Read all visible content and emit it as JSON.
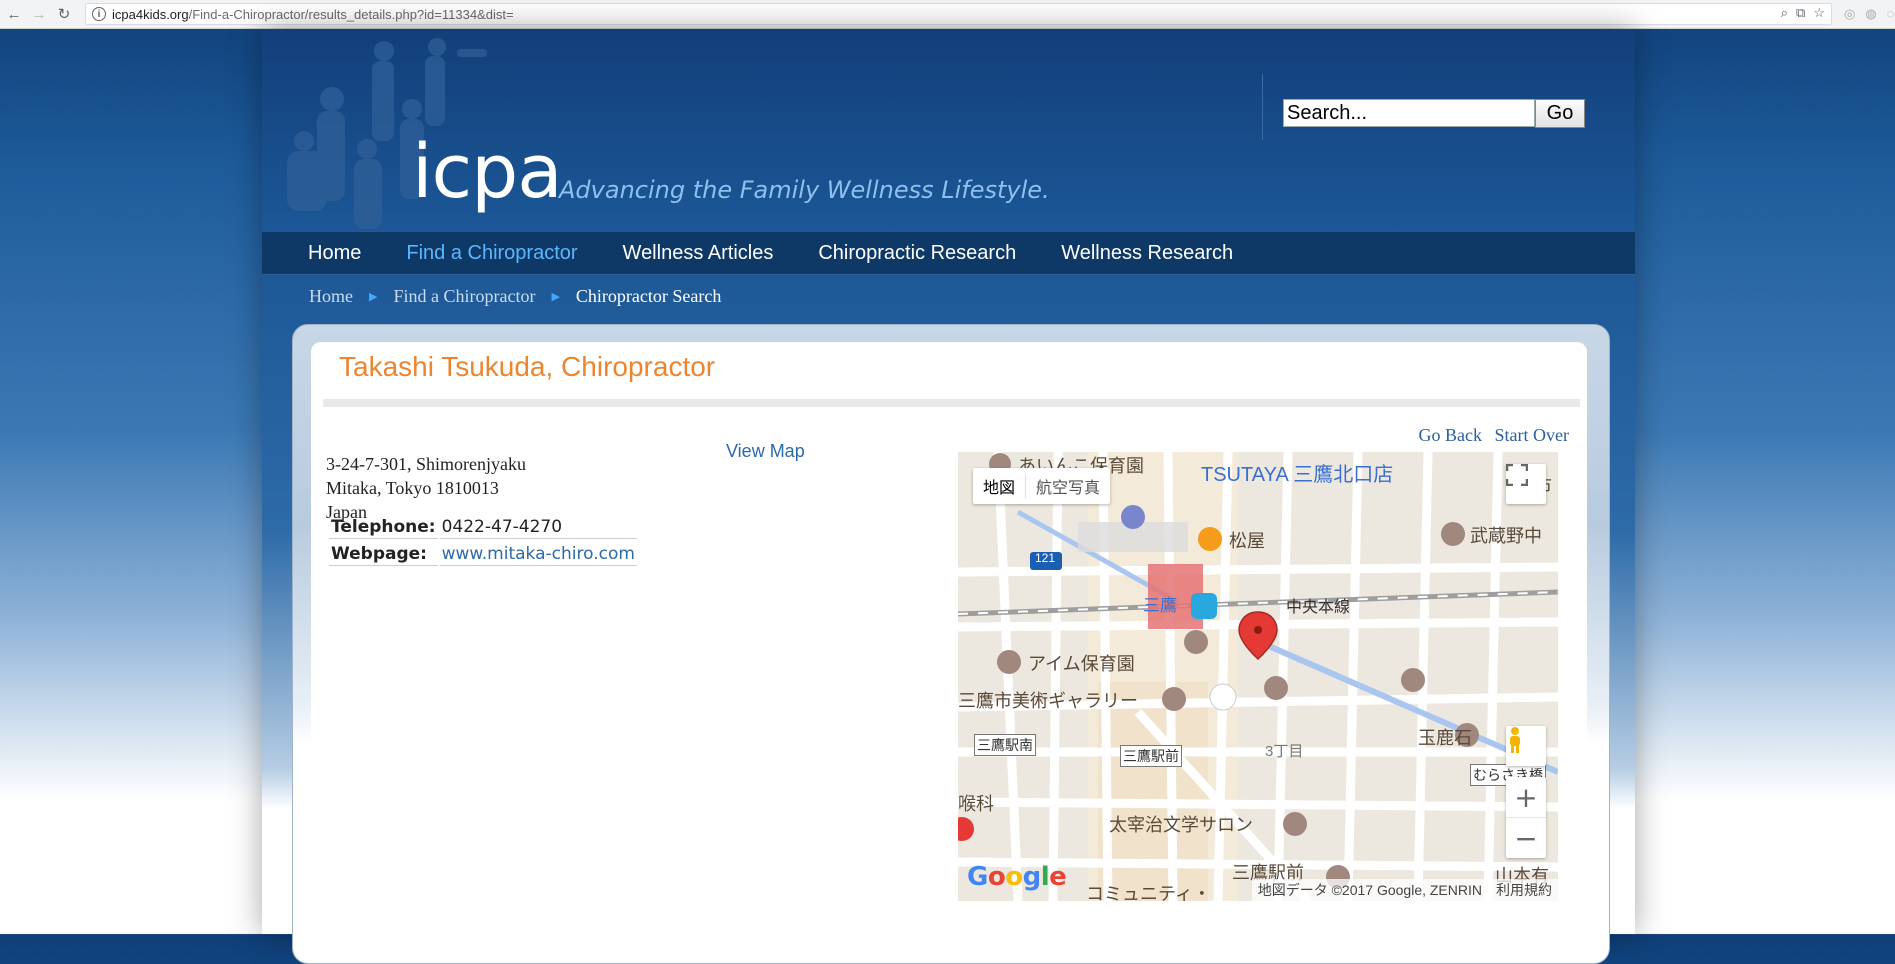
{
  "browser": {
    "url_host": "icpa4kids.org",
    "url_path": "/Find-a-Chiropractor/results_details.php?id=11334&dist="
  },
  "header": {
    "logo_text": "icpa",
    "tagline": "Advancing the Family Wellness Lifestyle.",
    "search_placeholder": "Search...",
    "search_button": "Go"
  },
  "nav": {
    "items": [
      {
        "label": "Home"
      },
      {
        "label": "Find a Chiropractor"
      },
      {
        "label": "Wellness Articles"
      },
      {
        "label": "Chiropractic Research"
      },
      {
        "label": "Wellness Research"
      }
    ]
  },
  "breadcrumb": {
    "items": [
      "Home",
      "Find a Chiropractor",
      "Chiropractor Search"
    ]
  },
  "detail": {
    "title": "Takashi Tsukuda, Chiropractor",
    "go_back": "Go Back",
    "start_over": "Start Over",
    "address_line1": "3-24-7-301, Shimorenjyaku",
    "address_line2": "Mitaka, Tokyo 1810013",
    "address_line3": "Japan",
    "view_map": "View Map",
    "telephone_label": "Telephone:",
    "telephone_value": "0422-47-4270",
    "webpage_label": "Webpage:",
    "webpage_value": "www.mitaka-chiro.com"
  },
  "map": {
    "type_map": "地図",
    "type_satellite": "航空写真",
    "labels": {
      "tsutaya": "TSUTAYA 三鷹北口店",
      "nursery_top": "あいんこ保育園",
      "matsuya": "松屋",
      "musashino": "武蔵野中",
      "station": "三鷹",
      "line": "中央本線",
      "route": "121",
      "aim": "アイム保育園",
      "gallery": "三鷹市美術ギャラリー",
      "stn_south": "三鷹駅南",
      "stn_front": "三鷹駅前",
      "chome": "3丁目",
      "tamashika": "玉鹿石",
      "murasaki": "むらさき橋",
      "dazai": "太宰治文学サロン",
      "stn_front2": "三鷹駅前",
      "community": "コミュニティ・",
      "yamamoto": "山本有",
      "clinic": "喉科",
      "nozomi": "野市"
    },
    "attribution": "地図データ ©2017 Google, ZENRIN",
    "terms": "利用規約",
    "zoom_in": "+",
    "zoom_out": "−"
  },
  "colors": {
    "accent_orange": "#ec8530",
    "nav_active": "#5ab7ff",
    "link_blue": "#2c6aa9"
  }
}
